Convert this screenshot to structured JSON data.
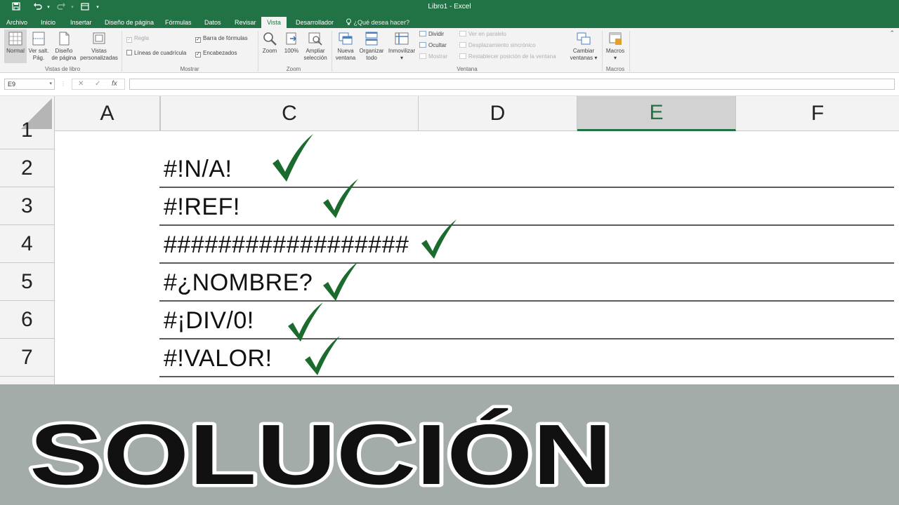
{
  "window": {
    "title": "Libro1 - Excel"
  },
  "tabs": [
    {
      "label": "Archivo",
      "active": false
    },
    {
      "label": "Inicio",
      "active": false
    },
    {
      "label": "Insertar",
      "active": false
    },
    {
      "label": "Diseño de página",
      "active": false
    },
    {
      "label": "Fórmulas",
      "active": false
    },
    {
      "label": "Datos",
      "active": false
    },
    {
      "label": "Revisar",
      "active": false
    },
    {
      "label": "Vista",
      "active": true
    },
    {
      "label": "Desarrollador",
      "active": false
    }
  ],
  "tell_me": "¿Qué desea hacer?",
  "ribbon": {
    "vistas": {
      "normal": "Normal",
      "ver_salt_1": "Ver salt.",
      "ver_salt_2": "Pág.",
      "diseno_1": "Diseño",
      "diseno_2": "de página",
      "personal_1": "Vistas",
      "personal_2": "personalizadas",
      "group": "Vistas de libro"
    },
    "mostrar": {
      "regla": "Regla",
      "lineas": "Líneas de cuadrícula",
      "barra": "Barra de fórmulas",
      "encabezados": "Encabezados",
      "group": "Mostrar"
    },
    "zoom": {
      "zoom": "Zoom",
      "cien": "100%",
      "ampliar_1": "Ampliar",
      "ampliar_2": "selección",
      "group": "Zoom"
    },
    "ventana": {
      "nueva_1": "Nueva",
      "nueva_2": "ventana",
      "organizar_1": "Organizar",
      "organizar_2": "todo",
      "inmovilizar": "Inmovilizar",
      "dividir": "Dividir",
      "ocultar": "Ocultar",
      "mostrar": "Mostrar",
      "paralelo": "Ver en paralelo",
      "sincronico": "Desplazamiento sincrónico",
      "restablecer": "Restablecer posición de la ventana",
      "cambiar_1": "Cambiar",
      "cambiar_2": "ventanas",
      "group": "Ventana"
    },
    "macros": {
      "label": "Macros",
      "group": "Macros"
    }
  },
  "formula_bar": {
    "name_box": "E9",
    "fx": "fx",
    "cancel": "✕",
    "enter": "✓",
    "value": ""
  },
  "columns": [
    {
      "label": "A",
      "selected": false
    },
    {
      "label": "C",
      "selected": false
    },
    {
      "label": "D",
      "selected": false
    },
    {
      "label": "E",
      "selected": true
    },
    {
      "label": "F",
      "selected": false
    }
  ],
  "rows": [
    "1",
    "2",
    "3",
    "4",
    "5",
    "6",
    "7"
  ],
  "cells": [
    "#!N/A!",
    "#!REF!",
    "##################",
    "#¿NOMBRE?",
    "#¡DIV/0!",
    "#!VALOR!"
  ],
  "colors": {
    "excel_green": "#217346",
    "check_green": "#1c6b2e",
    "banner_bg": "#a3aca9"
  },
  "icons": [
    "check-icon",
    "save-icon",
    "undo-icon",
    "redo-icon",
    "lightbulb-icon",
    "zoom-icon"
  ],
  "banner": {
    "text": "SOLUCIÓN"
  }
}
